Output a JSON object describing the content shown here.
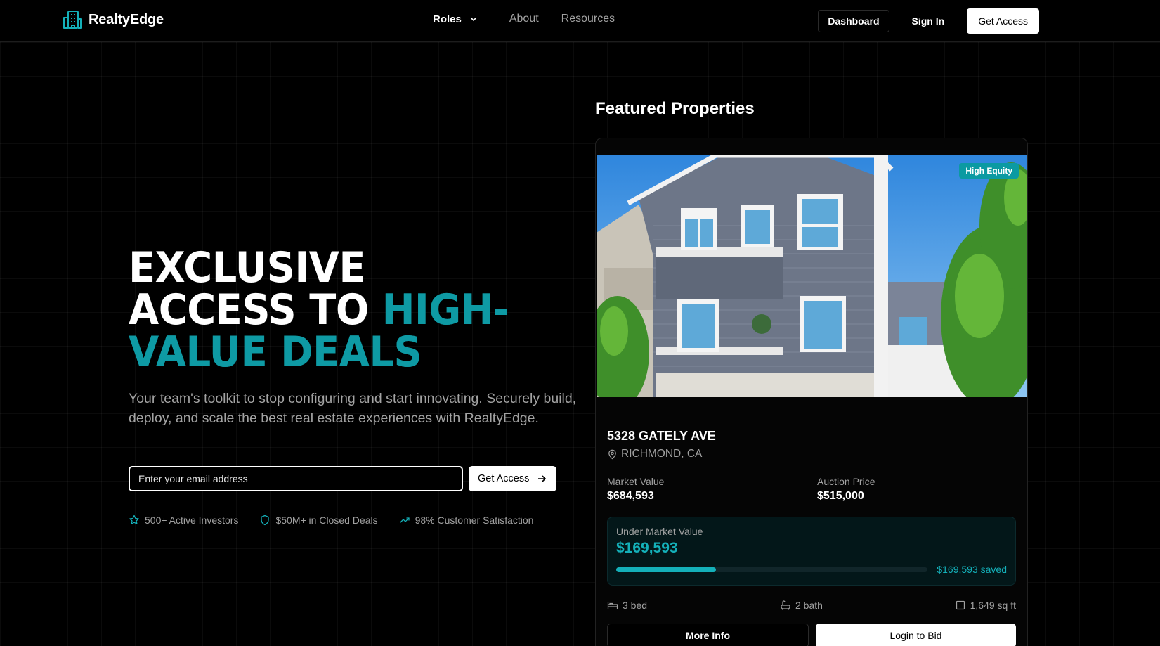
{
  "brand": {
    "name": "RealtyEdge",
    "accent": "#0e9aa4"
  },
  "nav": {
    "roles": "Roles",
    "about": "About",
    "resources": "Resources"
  },
  "header": {
    "dashboard": "Dashboard",
    "sign_in": "Sign In",
    "get_access": "Get Access"
  },
  "hero": {
    "line1": "EXCLUSIVE",
    "line2a": "ACCESS TO ",
    "line2b": "HIGH-",
    "line3": "VALUE DEALS",
    "subtitle": "Your team's toolkit to stop configuring and start innovating. Securely build, deploy, and scale the best real estate experiences with RealtyEdge.",
    "email_placeholder": "Enter your email address",
    "cta": "Get Access"
  },
  "stats": [
    {
      "icon": "star-icon",
      "text": "500+ Active Investors"
    },
    {
      "icon": "shield-icon",
      "text": "$50M+ in Closed Deals"
    },
    {
      "icon": "trending-up-icon",
      "text": "98% Customer Satisfaction"
    }
  ],
  "featured": {
    "title": "Featured Properties",
    "property": {
      "badge": "High Equity",
      "address": "5328 GATELY AVE",
      "location": "RICHMOND, CA",
      "market_value_label": "Market Value",
      "market_value": "$684,593",
      "auction_price_label": "Auction Price",
      "auction_price": "$515,000",
      "under_market_label": "Under Market Value",
      "under_market_value": "$169,593",
      "saved_text": "$169,593 saved",
      "savings_progress": 0.32,
      "beds": "3 bed",
      "baths": "2 bath",
      "area": "1,649 sq ft",
      "more_info": "More Info",
      "login_to_bid": "Login to Bid"
    }
  }
}
